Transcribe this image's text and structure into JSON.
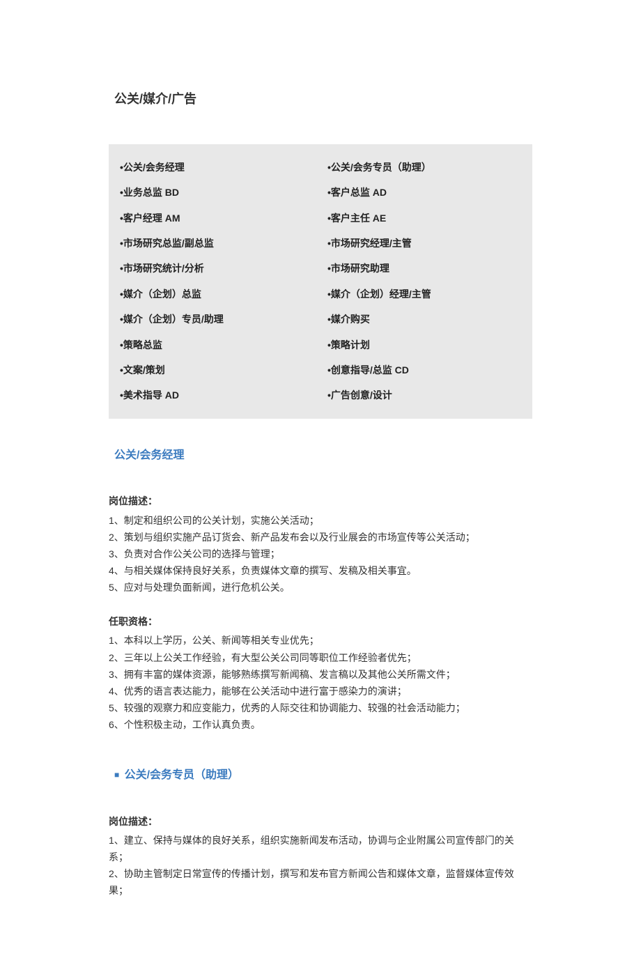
{
  "page_title": "公关/媒介/广告",
  "categories": [
    {
      "left": "•公关/会务经理",
      "right": "•公关/会务专员（助理）"
    },
    {
      "left": "•业务总监 BD",
      "right": "•客户总监 AD"
    },
    {
      "left": "•客户经理 AM",
      "right": "•客户主任 AE"
    },
    {
      "left": "•市场研究总监/副总监",
      "right": "•市场研究经理/主管"
    },
    {
      "left": "•市场研究统计/分析",
      "right": "•市场研究助理"
    },
    {
      "left": "•媒介（企划）总监",
      "right": "•媒介（企划）经理/主管"
    },
    {
      "left": "•媒介（企划）专员/助理",
      "right": "•媒介购买"
    },
    {
      "left": "•策略总监",
      "right": "•策略计划"
    },
    {
      "left": "•文案/策划",
      "right": "•创意指导/总监 CD"
    },
    {
      "left": "•美术指导 AD",
      "right": "•广告创意/设计"
    }
  ],
  "section1": {
    "title": "公关/会务经理",
    "desc_heading": "岗位描述：",
    "desc_items": [
      "1、制定和组织公司的公关计划，实施公关活动；",
      "2、策划与组织实施产品订货会、新产品发布会以及行业展会的市场宣传等公关活动；",
      "3、负责对合作公关公司的选择与管理；",
      "4、与相关媒体保持良好关系，负责媒体文章的撰写、发稿及相关事宜。",
      "5、应对与处理负面新闻，进行危机公关。"
    ],
    "qual_heading": "任职资格：",
    "qual_items": [
      "1、本科以上学历，公关、新闻等相关专业优先；",
      "2、三年以上公关工作经验，有大型公关公司同等职位工作经验者优先；",
      "3、拥有丰富的媒体资源，能够熟练撰写新闻稿、发言稿以及其他公关所需文件；",
      "4、优秀的语言表达能力，能够在公关活动中进行富于感染力的演讲；",
      "5、较强的观察力和应变能力，优秀的人际交往和协调能力、较强的社会活动能力；",
      "6、个性积极主动，工作认真负责。"
    ]
  },
  "section2": {
    "title": "公关/会务专员（助理）",
    "desc_heading": "岗位描述：",
    "desc_items": [
      "1、建立、保持与媒体的良好关系，组织实施新闻发布活动，协调与企业附属公司宣传部门的关系；",
      "2、协助主管制定日常宣传的传播计划，撰写和发布官方新闻公告和媒体文章，监督媒体宣传效果；"
    ]
  }
}
